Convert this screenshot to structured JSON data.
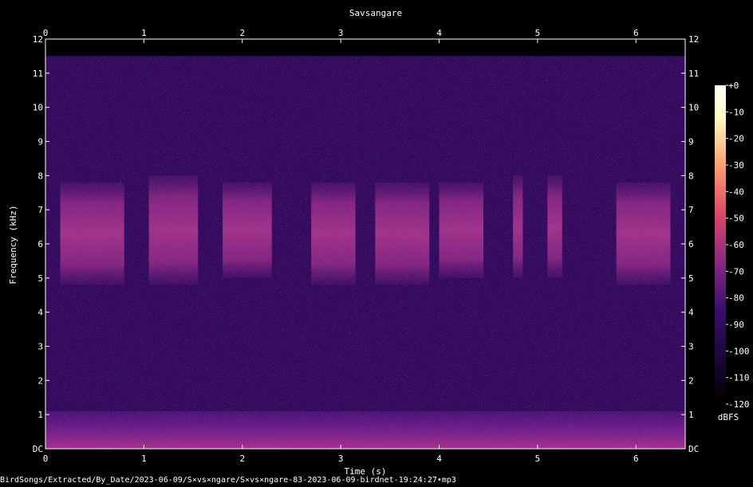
{
  "chart_data": {
    "type": "heatmap",
    "title": "Savsangare",
    "xlabel": "Time (s)",
    "ylabel": "Frequency (kHz)",
    "xlim": [
      0,
      6.5
    ],
    "ylim": [
      0,
      12
    ],
    "x_ticks": [
      "0",
      "1",
      "2",
      "3",
      "4",
      "5",
      "6"
    ],
    "y_ticks": [
      "DC",
      "1",
      "2",
      "3",
      "4",
      "5",
      "6",
      "7",
      "8",
      "9",
      "10",
      "11",
      "12"
    ],
    "colorbar": {
      "label": "dBFS",
      "range": [
        -120,
        0
      ],
      "ticks": [
        "+0",
        "-10",
        "-20",
        "-30",
        "-40",
        "-50",
        "-60",
        "-70",
        "-80",
        "-90",
        "-100",
        "-110",
        "-120"
      ],
      "colors": [
        "#000000",
        "#1a0638",
        "#3b0f70",
        "#8c2981",
        "#de4968",
        "#fe9f6d",
        "#fcfdbf",
        "#ffffff"
      ]
    },
    "background_level_dbfs": -100,
    "low_freq_band": {
      "freq_khz": [
        0,
        1.1
      ],
      "level_dbfs": -80
    },
    "syllables": [
      {
        "t_start": 0.15,
        "t_end": 0.8,
        "f_low_khz": 4.8,
        "f_high_khz": 7.8
      },
      {
        "t_start": 1.05,
        "t_end": 1.55,
        "f_low_khz": 4.8,
        "f_high_khz": 8.0
      },
      {
        "t_start": 1.8,
        "t_end": 2.3,
        "f_low_khz": 5.0,
        "f_high_khz": 7.8
      },
      {
        "t_start": 2.7,
        "t_end": 3.15,
        "f_low_khz": 4.8,
        "f_high_khz": 7.8
      },
      {
        "t_start": 3.35,
        "t_end": 3.9,
        "f_low_khz": 4.8,
        "f_high_khz": 7.8
      },
      {
        "t_start": 4.0,
        "t_end": 4.45,
        "f_low_khz": 5.0,
        "f_high_khz": 7.8
      },
      {
        "t_start": 4.75,
        "t_end": 4.85,
        "f_low_khz": 5.0,
        "f_high_khz": 8.0
      },
      {
        "t_start": 5.1,
        "t_end": 5.25,
        "f_low_khz": 5.0,
        "f_high_khz": 8.0
      },
      {
        "t_start": 5.8,
        "t_end": 6.35,
        "f_low_khz": 4.8,
        "f_high_khz": 7.8
      }
    ]
  },
  "footer_path": "BirdSongs/Extracted/By_Date/2023-06-09/S×vs×ngare/S×vs×ngare-83-2023-06-09-birdnet-19:24:27•mp3"
}
